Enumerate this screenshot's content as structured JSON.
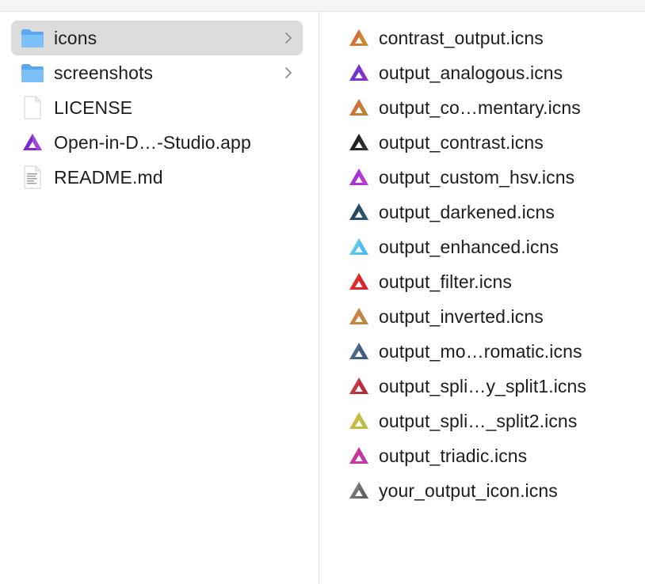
{
  "left_column": {
    "items": [
      {
        "label": "icons",
        "icon": "folder-icon",
        "selected": true,
        "has_children": true
      },
      {
        "label": "screenshots",
        "icon": "folder-icon",
        "selected": false,
        "has_children": true
      },
      {
        "label": "LICENSE",
        "icon": "document-icon",
        "selected": false,
        "has_children": false
      },
      {
        "label": "Open-in-D…-Studio.app",
        "icon": "app-icon",
        "selected": false,
        "has_children": false
      },
      {
        "label": "README.md",
        "icon": "text-document-icon",
        "selected": false,
        "has_children": false
      }
    ]
  },
  "right_column": {
    "items": [
      {
        "label": "contrast_output.icns",
        "colors": [
          "#e2533a",
          "#c8902e"
        ]
      },
      {
        "label": "output_analogous.icns",
        "colors": [
          "#5b3bd6",
          "#8a2fc8"
        ]
      },
      {
        "label": "output_co…mentary.icns",
        "colors": [
          "#e05a34",
          "#b58a3a"
        ]
      },
      {
        "label": "output_contrast.icns",
        "colors": [
          "#111111",
          "#333333"
        ]
      },
      {
        "label": "output_custom_hsv.icns",
        "colors": [
          "#8b2cc9",
          "#c03ad6"
        ]
      },
      {
        "label": "output_darkened.icns",
        "colors": [
          "#1f3a55",
          "#2c5a6e"
        ]
      },
      {
        "label": "output_enhanced.icns",
        "colors": [
          "#6fd3f2",
          "#4bb8e6"
        ]
      },
      {
        "label": "output_filter.icns",
        "colors": [
          "#e53a2b",
          "#d81f2a"
        ]
      },
      {
        "label": "output_inverted.icns",
        "colors": [
          "#e2763c",
          "#b88b47"
        ]
      },
      {
        "label": "output_mo…romatic.icns",
        "colors": [
          "#5a7490",
          "#3b5a7a"
        ]
      },
      {
        "label": "output_spli…y_split1.icns",
        "colors": [
          "#d8404a",
          "#b02a3a"
        ]
      },
      {
        "label": "output_spli…_split2.icns",
        "colors": [
          "#d9b23a",
          "#b8c04a"
        ]
      },
      {
        "label": "output_triadic.icns",
        "colors": [
          "#d8357e",
          "#b83ab0"
        ]
      },
      {
        "label": "your_output_icon.icns",
        "colors": [
          "#8a8a8a",
          "#5e5e5e"
        ]
      }
    ]
  }
}
